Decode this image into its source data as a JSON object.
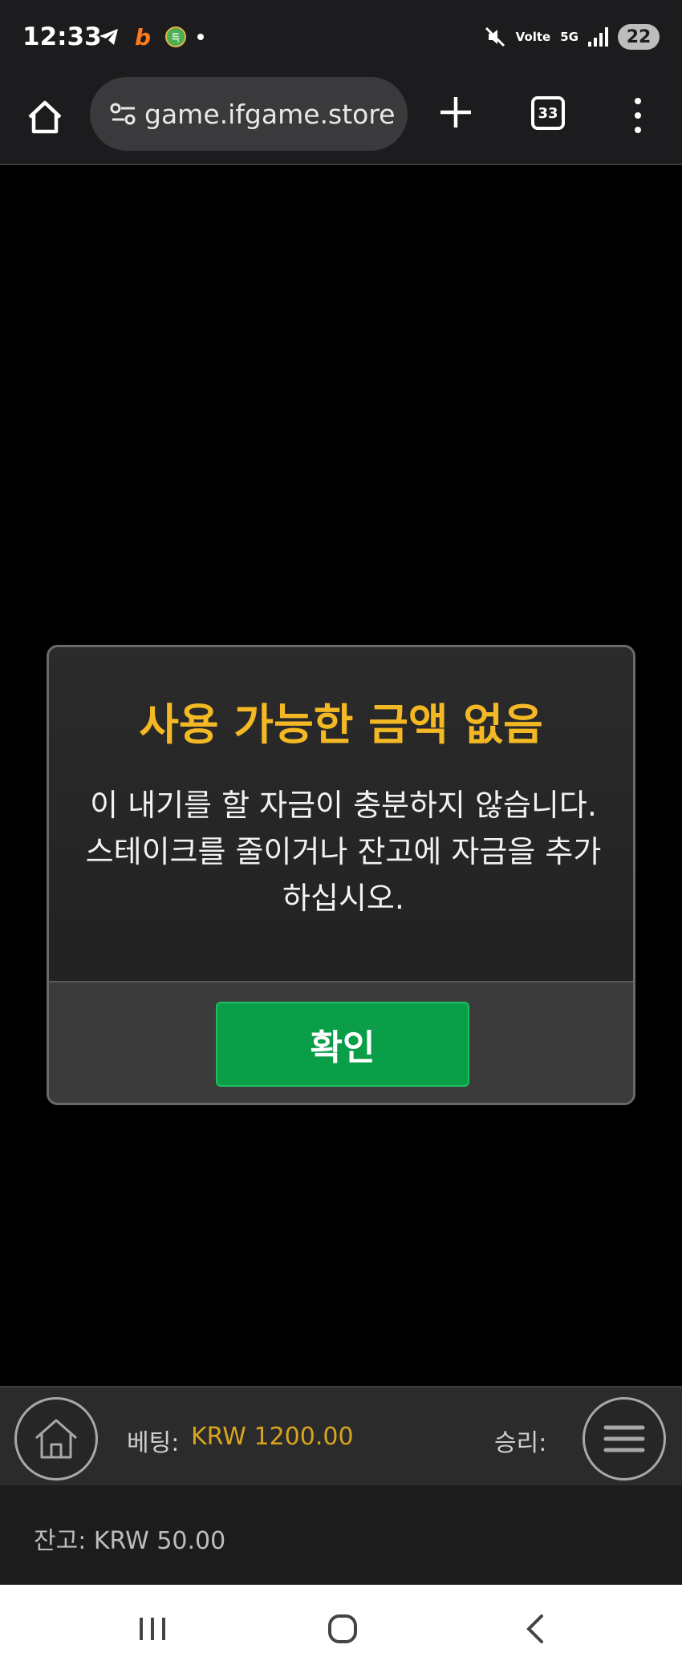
{
  "status_bar": {
    "time": "12:33",
    "network_label": "5G",
    "volte_label": "Volte",
    "battery": "22",
    "app_badge": "특"
  },
  "browser": {
    "url": "game.ifgame.store",
    "tab_count": "33"
  },
  "dialog": {
    "title": "사용 가능한 금액 없음",
    "message": "이 내기를 할 자금이 충분하지 않습니다. 스테이크를 줄이거나 잔고에 자금을 추가하십시오.",
    "confirm_label": "확인"
  },
  "game_bar": {
    "bet_label": "베팅:",
    "bet_value": "KRW 1200.00",
    "win_label": "승리:",
    "balance": "잔고: KRW 50.00"
  },
  "colors": {
    "title_accent": "#f3b824",
    "confirm_button": "#0a9e49",
    "bet_value": "#d9a41e"
  }
}
